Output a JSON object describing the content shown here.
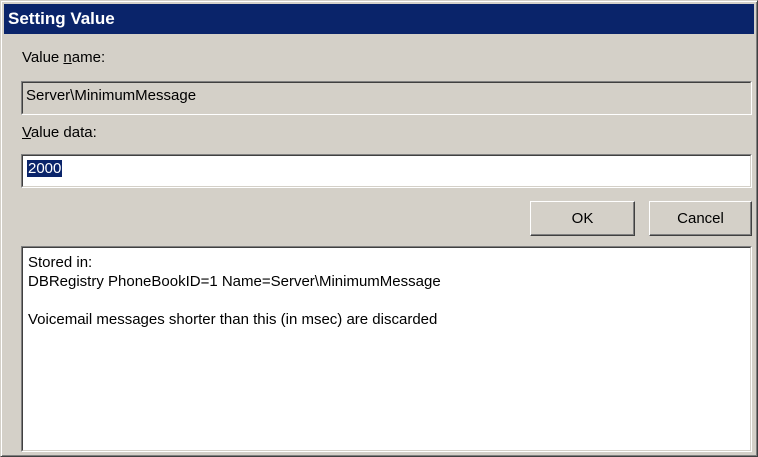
{
  "dialog": {
    "title": "Setting Value",
    "value_name_label_pre": "Value ",
    "value_name_label_u": "n",
    "value_name_label_post": "ame:",
    "value_name": "Server\\MinimumMessage",
    "value_data_label_u": "V",
    "value_data_label_post": "alue data:",
    "value_data": "2000",
    "ok_label": "OK",
    "cancel_label": "Cancel",
    "info": {
      "line1": "Stored in:",
      "line2": "DBRegistry PhoneBookID=1 Name=Server\\MinimumMessage",
      "line3": "Voicemail messages shorter than this (in msec) are discarded"
    }
  }
}
